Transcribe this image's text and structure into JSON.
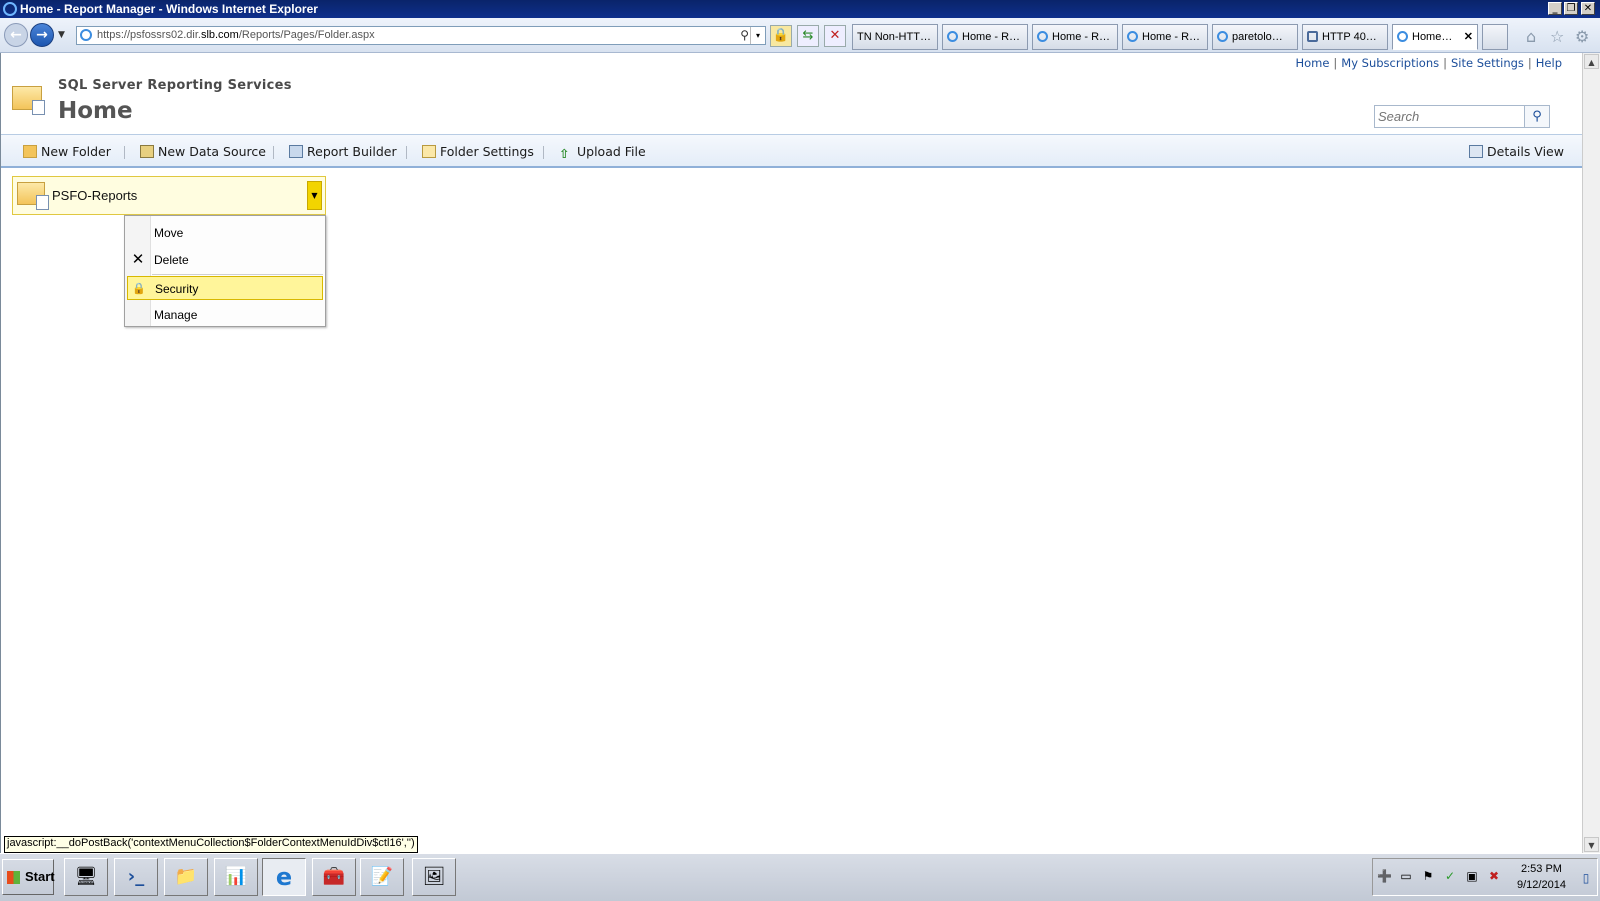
{
  "window": {
    "title": "Home - Report Manager - Windows Internet Explorer",
    "minimize": "_",
    "restore": "❐",
    "close": "✕"
  },
  "browser": {
    "back_glyph": "←",
    "forward_glyph": "→",
    "nav_dropdown_glyph": "▼",
    "url_prefix": "https://psfossrs02.dir.",
    "url_domain": "slb.com",
    "url_path": "/Reports/Pages/Folder.aspx",
    "search_glyph": "⚲",
    "dropdown_glyph": "▾",
    "lock_glyph": "🔒",
    "refresh_glyph": "⇆",
    "stop_glyph": "✕",
    "tabs": [
      {
        "label": "TN Non-HTT…",
        "icon": "tn-icon"
      },
      {
        "label": "Home - R…",
        "icon": "ie-page-icon"
      },
      {
        "label": "Home - R…",
        "icon": "ie-page-icon"
      },
      {
        "label": "Home - R…",
        "icon": "ie-page-icon"
      },
      {
        "label": "paretolo…",
        "icon": "ie-page-icon"
      },
      {
        "label": "HTTP 40…",
        "icon": "http-icon"
      },
      {
        "label": "Home…",
        "icon": "ie-page-icon",
        "active": true
      }
    ],
    "tab_close_glyph": "✕",
    "home_glyph": "⌂",
    "favorites_glyph": "☆",
    "tools_glyph": "⚙"
  },
  "header": {
    "links": [
      "Home",
      "My Subscriptions",
      "Site Settings",
      "Help"
    ],
    "link_separator": "|",
    "product_name": "SQL Server Reporting Services",
    "page_title": "Home",
    "search_placeholder": "Search",
    "search_button_glyph": "⚲"
  },
  "commands": {
    "new_folder": "New Folder",
    "new_data_source": "New Data Source",
    "report_builder": "Report Builder",
    "folder_settings": "Folder Settings",
    "upload_file": "Upload File",
    "details_view": "Details View",
    "upload_arrow": "⇧"
  },
  "folder": {
    "name": "PSFO-Reports",
    "dropdown_glyph": "▼"
  },
  "context_menu": {
    "items": [
      {
        "label": "Move",
        "icon": ""
      },
      {
        "label": "Delete",
        "icon": "✕"
      },
      {
        "label": "Security",
        "icon": "🔒",
        "highlighted": true
      },
      {
        "label": "Manage",
        "icon": ""
      }
    ]
  },
  "status_text": "javascript:__doPostBack('contextMenuCollection$FolderContextMenuIdDiv$ctl16','')",
  "scrollbar": {
    "up": "▲",
    "down": "▼"
  },
  "taskbar": {
    "start_label": "Start",
    "apps": [
      "server-manager-icon",
      "powershell-icon",
      "explorer-icon",
      "report-icon",
      "internet-explorer-icon",
      "toolbox-icon",
      "notepad-icon",
      "image-viewer-icon"
    ],
    "app_glyphs": [
      "🖥",
      "›_",
      "📁",
      "📊",
      "e",
      "🧰",
      "📝",
      "🖼"
    ],
    "tray_glyphs": [
      "➕",
      "▭",
      "⚑",
      "✓",
      "▣",
      "✖",
      "▯"
    ],
    "clock_time": "2:53 PM",
    "clock_date": "9/12/2014"
  }
}
